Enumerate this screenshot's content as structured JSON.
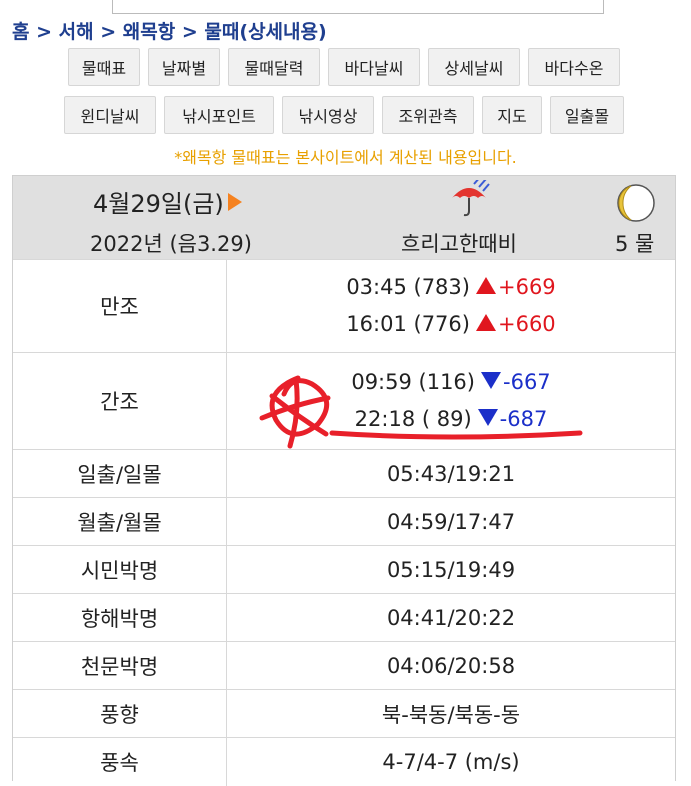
{
  "breadcrumb": [
    "홈",
    "서해",
    "왜목항",
    "물때(상세내용)"
  ],
  "breadcrumb_sep": ">",
  "menu_row1": [
    "물때표",
    "날짜별",
    "물때달력",
    "바다날씨",
    "상세날씨",
    "바다수온"
  ],
  "menu_row2": [
    "윈디날씨",
    "낚시포인트",
    "낚시영상",
    "조위관측",
    "지도",
    "일출몰"
  ],
  "notice": "*왜목항 물때표는 본사이트에서 계산된 내용입니다.",
  "day": {
    "date": "4월29일(금)",
    "year_lunar": "2022년 (음3.29)",
    "weather": "흐리고한때비",
    "weather_icon": "umbrella-rain-icon",
    "moon_icon": "crescent-moon-icon",
    "tide_age": "5 물"
  },
  "high_tide": {
    "label": "만조",
    "entries": [
      {
        "time": "03:45 (783)",
        "diff": "+669"
      },
      {
        "time": "16:01 (776)",
        "diff": "+660"
      }
    ]
  },
  "low_tide": {
    "label": "간조",
    "entries": [
      {
        "time": "09:59 (116)",
        "diff": "-667"
      },
      {
        "time": "22:18 ( 89)",
        "diff": "-687"
      }
    ]
  },
  "rows": [
    {
      "label": "일출/일몰",
      "value": "05:43/19:21"
    },
    {
      "label": "월출/월몰",
      "value": "04:59/17:47"
    },
    {
      "label": "시민박명",
      "value": "05:15/19:49"
    },
    {
      "label": "항해박명",
      "value": "04:41/20:22"
    },
    {
      "label": "천문박명",
      "value": "04:06/20:58"
    },
    {
      "label": "풍향",
      "value": "북-북동/북동-동"
    },
    {
      "label": "풍속",
      "value": "4-7/4-7 (m/s)"
    }
  ],
  "colors": {
    "breadcrumb": "#1f3f8f",
    "notice": "#e8a000",
    "high": "#e0161e",
    "low": "#1b2fc9",
    "annotation": "#e8202a",
    "header_bg": "#e0e0e0"
  }
}
